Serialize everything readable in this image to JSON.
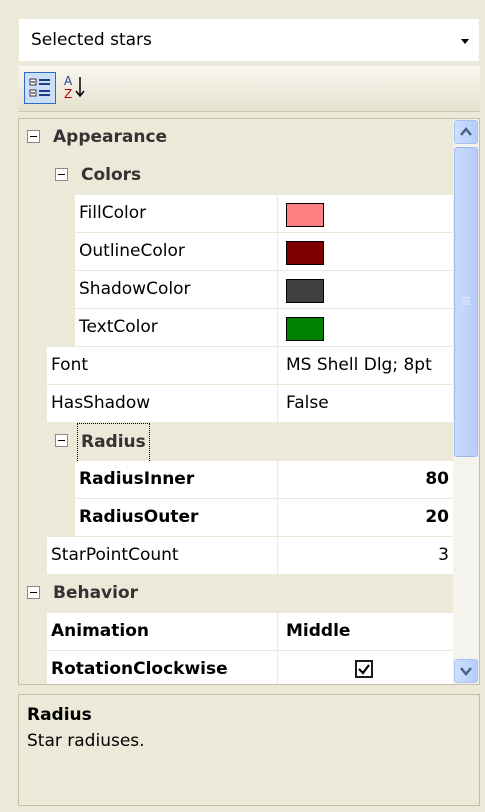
{
  "combo": {
    "selected": "Selected stars"
  },
  "toolbar": {
    "categorized_icon": "categorized-icon",
    "alphabetical_icon": "alphabetical-sort-icon",
    "alphabetical_glyph": "A Z"
  },
  "grid": {
    "appearance": {
      "label": "Appearance"
    },
    "colors": {
      "label": "Colors"
    },
    "fill_color": {
      "name": "FillColor",
      "color": "#ff8080"
    },
    "outline_color": {
      "name": "OutlineColor",
      "color": "#800000"
    },
    "shadow_color": {
      "name": "ShadowColor",
      "color": "#404040"
    },
    "text_color": {
      "name": "TextColor",
      "color": "#008000"
    },
    "font": {
      "name": "Font",
      "value": "MS Shell Dlg; 8pt"
    },
    "has_shadow": {
      "name": "HasShadow",
      "value": "False"
    },
    "radius": {
      "label": "Radius"
    },
    "radius_inner": {
      "name": "RadiusInner",
      "value": "80"
    },
    "radius_outer": {
      "name": "RadiusOuter",
      "value": "20"
    },
    "star_point_count": {
      "name": "StarPointCount",
      "value": "3"
    },
    "behavior": {
      "label": "Behavior"
    },
    "animation": {
      "name": "Animation",
      "value": "Middle"
    },
    "rotation_clockwise": {
      "name": "RotationClockwise",
      "checked": true
    }
  },
  "help": {
    "title": "Radius",
    "description": "Star radiuses."
  }
}
